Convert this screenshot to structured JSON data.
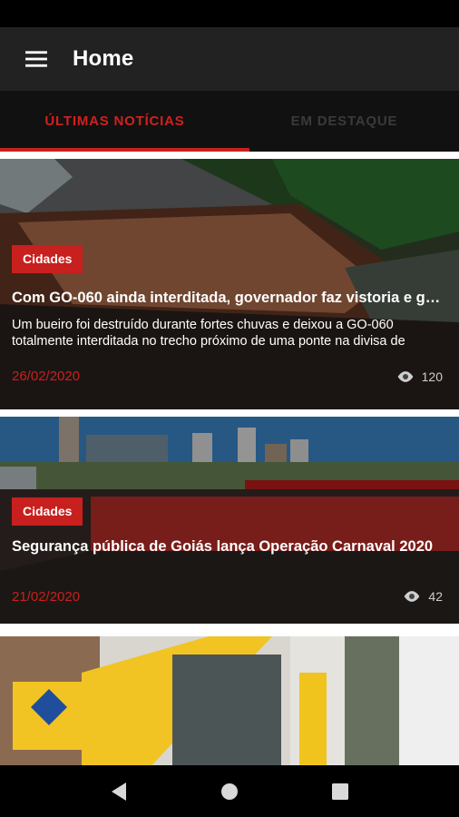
{
  "app_bar": {
    "title": "Home",
    "menu_icon": "menu-icon"
  },
  "tabs": [
    {
      "label": "ÚLTIMAS NOTÍCIAS",
      "active": true
    },
    {
      "label": "EM DESTAQUE",
      "active": false
    }
  ],
  "articles": [
    {
      "category": "Cidades",
      "title": "Com GO-060 ainda interditada, governador faz vistoria e g…",
      "excerpt": "Um bueiro foi destruído durante fortes chuvas e deixou a GO-060 totalmente interditada no trecho próximo de uma ponte na divisa de",
      "date": "26/02/2020",
      "views": "120",
      "views_icon": "eye-icon"
    },
    {
      "category": "Cidades",
      "title": "Segurança pública de Goiás lança Operação Carnaval 2020",
      "date": "21/02/2020",
      "views": "42",
      "views_icon": "eye-icon"
    }
  ],
  "system_nav": {
    "back_icon": "back-icon",
    "home_icon": "home-icon",
    "recents_icon": "recents-icon"
  },
  "colors": {
    "accent": "#c8201e",
    "app_bar": "#222222",
    "tabs_bg": "#111111"
  }
}
